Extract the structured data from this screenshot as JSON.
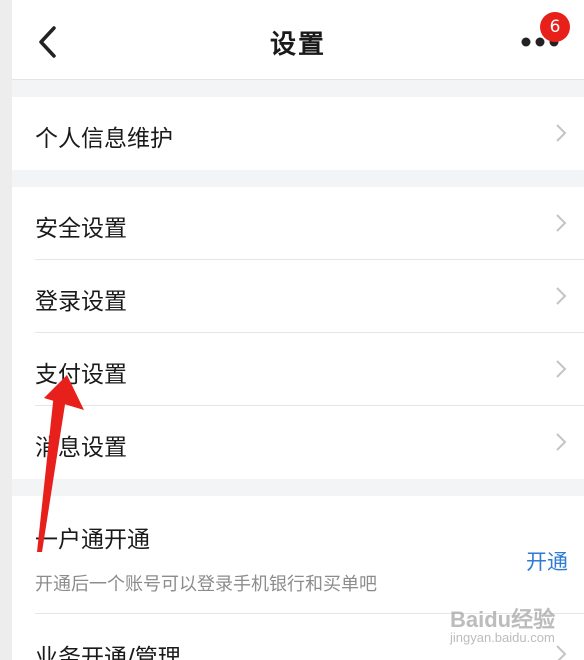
{
  "header": {
    "title": "设置",
    "back_icon": "chevron-left-icon",
    "more_icon": "more-dots-icon",
    "badge_count": "6",
    "badge_color": "#e8201c"
  },
  "groups": [
    {
      "items": [
        {
          "label": "个人信息维护"
        }
      ]
    },
    {
      "items": [
        {
          "label": "安全设置"
        },
        {
          "label": "登录设置"
        },
        {
          "label": "支付设置"
        },
        {
          "label": "消息设置"
        }
      ]
    },
    {
      "items": [
        {
          "label": "一户通开通",
          "subtitle": "开通后一个账号可以登录手机银行和买单吧",
          "action": "开通"
        },
        {
          "label": "业务开通/管理"
        }
      ]
    }
  ],
  "colors": {
    "accent": "#2e7bd6",
    "annotation_arrow": "#e8201c"
  },
  "watermark": {
    "brand": "Baidu经验",
    "url": "jingyan.baidu.com"
  }
}
